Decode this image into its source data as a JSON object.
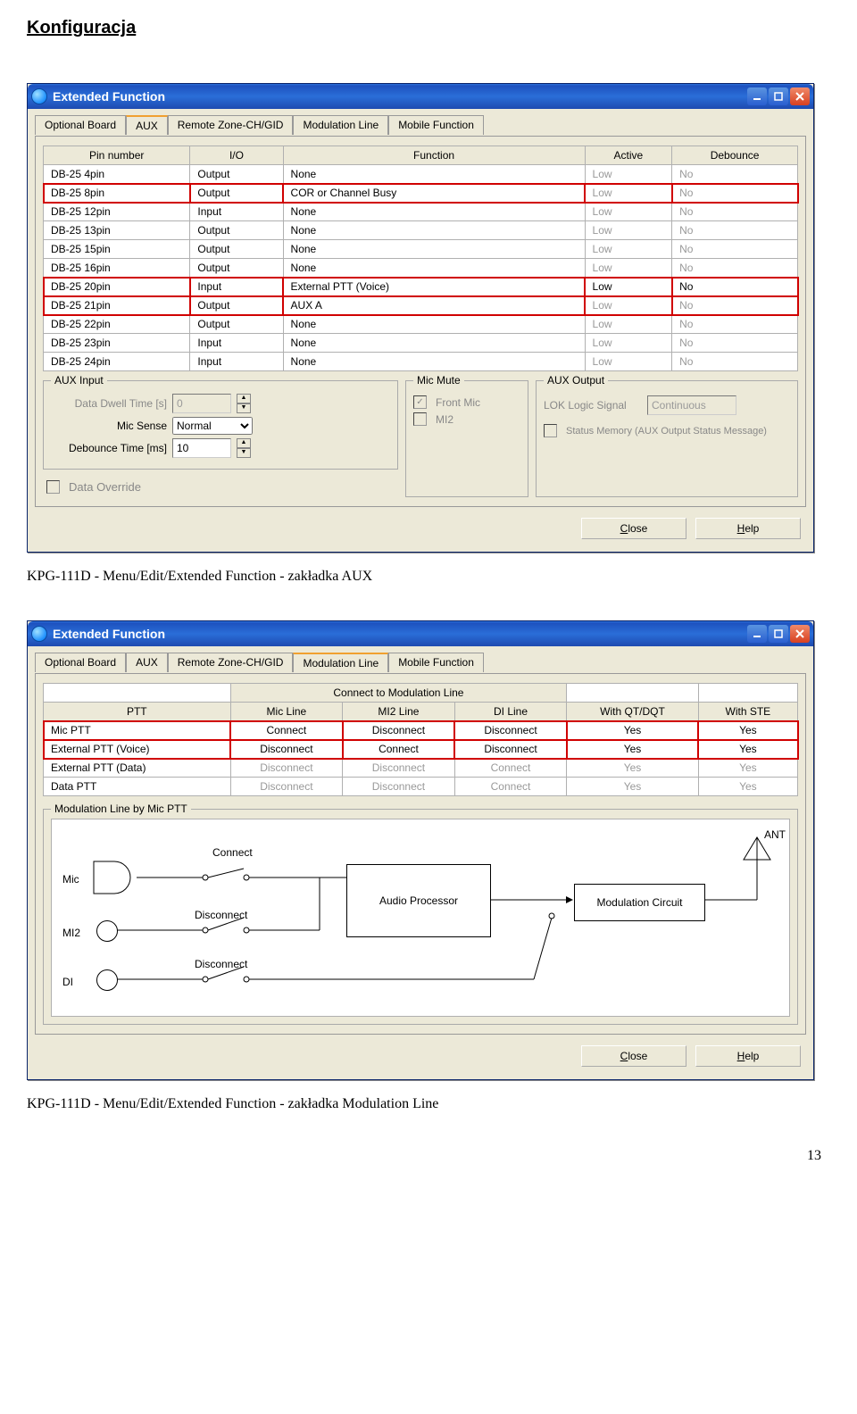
{
  "page": {
    "title": "Konfiguracja",
    "number": "13"
  },
  "caption1": "KPG-111D - Menu/Edit/Extended Function - zakładka AUX",
  "caption2": "KPG-111D - Menu/Edit/Extended Function - zakładka Modulation Line",
  "win1": {
    "title": "Extended Function",
    "tabs": [
      "Optional Board",
      "AUX",
      "Remote Zone-CH/GID",
      "Modulation Line",
      "Mobile Function"
    ],
    "activeTab": "AUX",
    "headers": [
      "Pin number",
      "I/O",
      "Function",
      "Active",
      "Debounce"
    ],
    "rows": [
      {
        "pin": "DB-25  4pin",
        "io": "Output",
        "fn": "None",
        "act": "Low",
        "deb": "No",
        "dim": true
      },
      {
        "pin": "DB-25  8pin",
        "io": "Output",
        "fn": "COR or Channel Busy",
        "act": "Low",
        "deb": "No",
        "dim": true,
        "hl": true
      },
      {
        "pin": "DB-25 12pin",
        "io": "Input",
        "fn": "None",
        "act": "Low",
        "deb": "No",
        "dim": true
      },
      {
        "pin": "DB-25 13pin",
        "io": "Output",
        "fn": "None",
        "act": "Low",
        "deb": "No",
        "dim": true
      },
      {
        "pin": "DB-25 15pin",
        "io": "Output",
        "fn": "None",
        "act": "Low",
        "deb": "No",
        "dim": true
      },
      {
        "pin": "DB-25 16pin",
        "io": "Output",
        "fn": "None",
        "act": "Low",
        "deb": "No",
        "dim": true
      },
      {
        "pin": "DB-25 20pin",
        "io": "Input",
        "fn": "External PTT (Voice)",
        "act": "Low",
        "deb": "No",
        "dim": false,
        "hl": true
      },
      {
        "pin": "DB-25 21pin",
        "io": "Output",
        "fn": "AUX A",
        "act": "Low",
        "deb": "No",
        "dim": true,
        "hl": true
      },
      {
        "pin": "DB-25 22pin",
        "io": "Output",
        "fn": "None",
        "act": "Low",
        "deb": "No",
        "dim": true
      },
      {
        "pin": "DB-25 23pin",
        "io": "Input",
        "fn": "None",
        "act": "Low",
        "deb": "No",
        "dim": true
      },
      {
        "pin": "DB-25 24pin",
        "io": "Input",
        "fn": "None",
        "act": "Low",
        "deb": "No",
        "dim": true
      }
    ],
    "auxInput": {
      "legend": "AUX Input",
      "dwellLabel": "Data Dwell Time [s]",
      "dwell": "0",
      "micSenseLabel": "Mic Sense",
      "micSense": "Normal",
      "debounceLabel": "Debounce Time [ms]",
      "debounce": "10",
      "dataOverride": "Data Override"
    },
    "micMute": {
      "legend": "Mic Mute",
      "front": "Front Mic",
      "mi2": "MI2"
    },
    "auxOutput": {
      "legend": "AUX Output",
      "lokLabel": "LOK Logic Signal",
      "lok": "Continuous",
      "status": "Status Memory (AUX Output Status Message)"
    },
    "close": "Close",
    "help": "Help"
  },
  "win2": {
    "title": "Extended Function",
    "tabs": [
      "Optional Board",
      "AUX",
      "Remote Zone-CH/GID",
      "Modulation Line",
      "Mobile Function"
    ],
    "activeTab": "Modulation Line",
    "topHeader": "Connect to Modulation Line",
    "headers": [
      "PTT",
      "Mic Line",
      "MI2 Line",
      "DI Line",
      "With QT/DQT",
      "With STE"
    ],
    "rows": [
      {
        "c": [
          "Mic PTT",
          "Connect",
          "Disconnect",
          "Disconnect",
          "Yes",
          "Yes"
        ],
        "dim": false,
        "hl": true
      },
      {
        "c": [
          "External PTT (Voice)",
          "Disconnect",
          "Connect",
          "Disconnect",
          "Yes",
          "Yes"
        ],
        "dim": false,
        "hl": true
      },
      {
        "c": [
          "External PTT (Data)",
          "Disconnect",
          "Disconnect",
          "Connect",
          "Yes",
          "Yes"
        ],
        "dim": true
      },
      {
        "c": [
          "Data PTT",
          "Disconnect",
          "Disconnect",
          "Connect",
          "Yes",
          "Yes"
        ],
        "dim": true
      }
    ],
    "diagram": {
      "legend": "Modulation Line by Mic PTT",
      "mic": "Mic",
      "mi2": "MI2",
      "di": "DI",
      "connect": "Connect",
      "disconnect": "Disconnect",
      "audio": "Audio Processor",
      "mod": "Modulation Circuit",
      "ant": "ANT"
    },
    "close": "Close",
    "help": "Help"
  }
}
